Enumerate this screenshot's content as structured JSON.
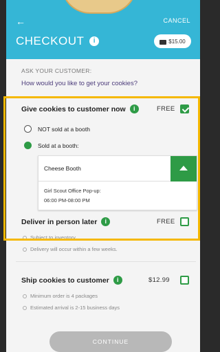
{
  "header": {
    "title": "CHECKOUT",
    "cancel_label": "CANCEL",
    "cart_total": "$15.00",
    "info_icon": "i",
    "back_icon": "←"
  },
  "ask": {
    "label": "ASK YOUR CUSTOMER:",
    "question": "How would you like to get your cookies?"
  },
  "options": {
    "give_now": {
      "title": "Give cookies to customer now",
      "price": "FREE",
      "checked": true
    },
    "not_booth": {
      "label": "NOT sold at a booth",
      "selected": false
    },
    "sold_booth": {
      "label": "Sold at a booth:",
      "selected": true
    },
    "booth": {
      "selected_value": "Cheese Booth",
      "detail_line1": "Girl Scout Office Pop-up:",
      "detail_line2": "06:00 PM-08:00 PM"
    },
    "deliver_later": {
      "title": "Deliver in person later",
      "price": "FREE",
      "checked": false,
      "notes": [
        "Subject to inventory",
        "Delivery will occur within a few weeks."
      ]
    },
    "ship": {
      "title": "Ship cookies to customer",
      "price": "$12.99",
      "checked": false,
      "notes": [
        "Minimum order is 4 packages",
        "Estimated arrival is 2-15 business days"
      ]
    }
  },
  "continue_label": "CONTINUE",
  "colors": {
    "header": "#35b6d6",
    "accent_green": "#2e9b46",
    "highlight": "#f5b800",
    "question": "#4b3b7a"
  }
}
